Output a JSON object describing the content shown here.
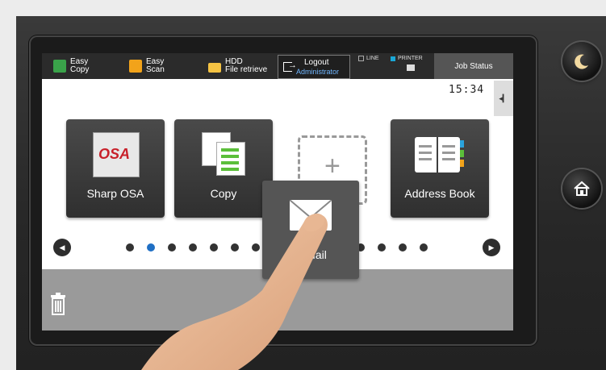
{
  "topbar": {
    "easy_copy": {
      "line1": "Easy",
      "line2": "Copy",
      "icon": "easy-copy-icon",
      "color": "#3aa34a"
    },
    "easy_scan": {
      "line1": "Easy",
      "line2": "Scan",
      "icon": "easy-scan-icon",
      "color": "#f2a31a"
    },
    "hdd": {
      "line1": "HDD",
      "line2": "File retrieve",
      "icon": "folder-icon",
      "color": "#f5c343"
    },
    "logout": {
      "label": "Logout",
      "user": "Administrator"
    },
    "line_label": "LINE",
    "printer_label": "PRINTER",
    "job_status": "Job Status"
  },
  "clock": "15:34",
  "tiles": [
    {
      "label": "Sharp OSA",
      "logo_text": "OSA"
    },
    {
      "label": "Copy"
    },
    {
      "label": "Address Book"
    }
  ],
  "popup": {
    "label": "E-Mail",
    "icon": "envelope-icon"
  },
  "pagination": {
    "total": 15,
    "active": 2
  },
  "colors": {
    "active_dot": "#1f6fc4",
    "accent_blue": "#6fb6ff",
    "printer_square": "#1aa7d6"
  }
}
